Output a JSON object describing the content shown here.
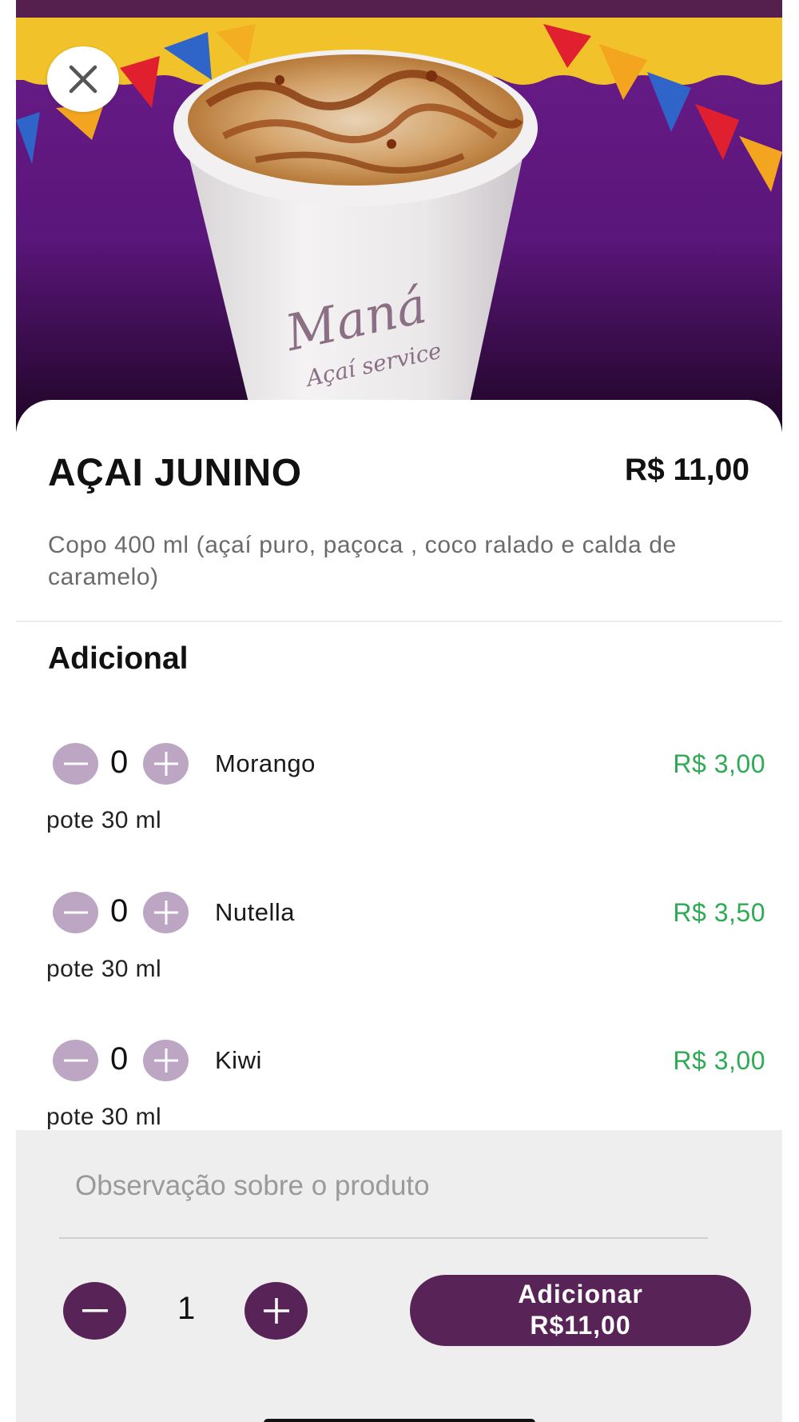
{
  "product": {
    "title": "AÇAI JUNINO",
    "price": "R$ 11,00",
    "description": "Copo 400 ml (açaí puro, paçoca , coco ralado e calda de caramelo)",
    "image_icon": "acai-cup-image",
    "cup_logo_text": "Maná Açaí service"
  },
  "close": {
    "icon": "close-icon"
  },
  "addons": {
    "section_title": "Adicional",
    "items": [
      {
        "name": "Morango",
        "price": "R$ 3,00",
        "qty": "0",
        "subtitle": "pote 30 ml"
      },
      {
        "name": "Nutella",
        "price": "R$ 3,50",
        "qty": "0",
        "subtitle": "pote 30 ml"
      },
      {
        "name": "Kiwi",
        "price": "R$ 3,00",
        "qty": "0",
        "subtitle": "pote 30 ml"
      }
    ]
  },
  "footer": {
    "observation_placeholder": "Observação sobre o produto",
    "observation_value": "",
    "quantity": "1",
    "add_button_line1": "Adicionar",
    "add_button_line2": "R$11,00"
  },
  "colors": {
    "brand_purple": "#582457",
    "addon_button": "#bca6c4",
    "price_green": "#2faa55",
    "footer_bg": "#eeeeee"
  }
}
